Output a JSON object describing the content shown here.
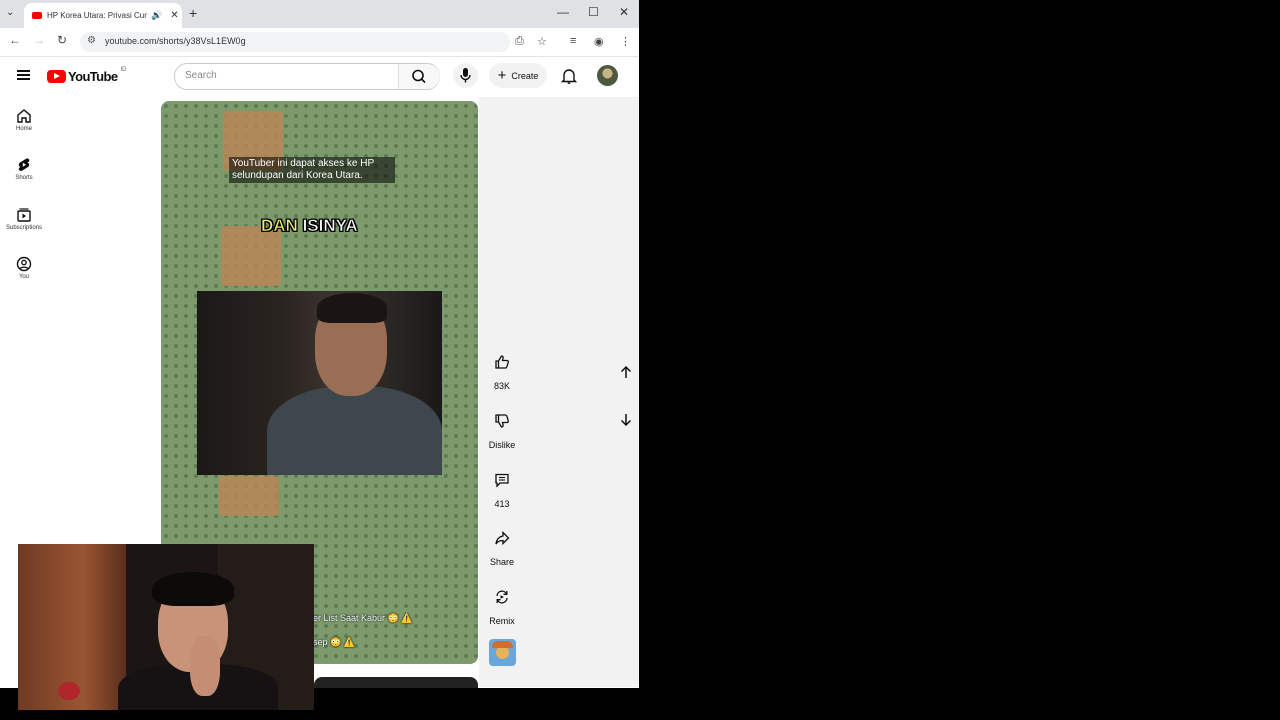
{
  "browser": {
    "tab_title": "HP Korea Utara: Privasi Cum",
    "url": "youtube.com/shorts/y38VsL1EW0g"
  },
  "header": {
    "logo_text": "YouTube",
    "logo_sup": "ID",
    "search_placeholder": "Search",
    "create_label": "Create"
  },
  "guide": {
    "items": [
      {
        "label": "Home",
        "icon": "home-icon"
      },
      {
        "label": "Shorts",
        "icon": "shorts-icon"
      },
      {
        "label": "Subscriptions",
        "icon": "subscriptions-icon"
      },
      {
        "label": "You",
        "icon": "you-icon"
      }
    ]
  },
  "short": {
    "caption_line1": "YouTuber ini dapat akses ke HP",
    "caption_line2": "selundupan dari Korea Utara.",
    "big_caption_a": "DAN",
    "big_caption_b": "ISINYA",
    "overlay_line1": "er List Saat Kabur 😳 ⚠️",
    "overlay_line2": "sep 😳 ⚠️"
  },
  "actions": {
    "like_count": "83K",
    "dislike_label": "Dislike",
    "comment_count": "413",
    "share_label": "Share",
    "remix_label": "Remix"
  },
  "colors": {
    "brand_red": "#ff0000",
    "short_bg": "#7c9a6b",
    "caption_highlight": "#e9ee6c"
  }
}
